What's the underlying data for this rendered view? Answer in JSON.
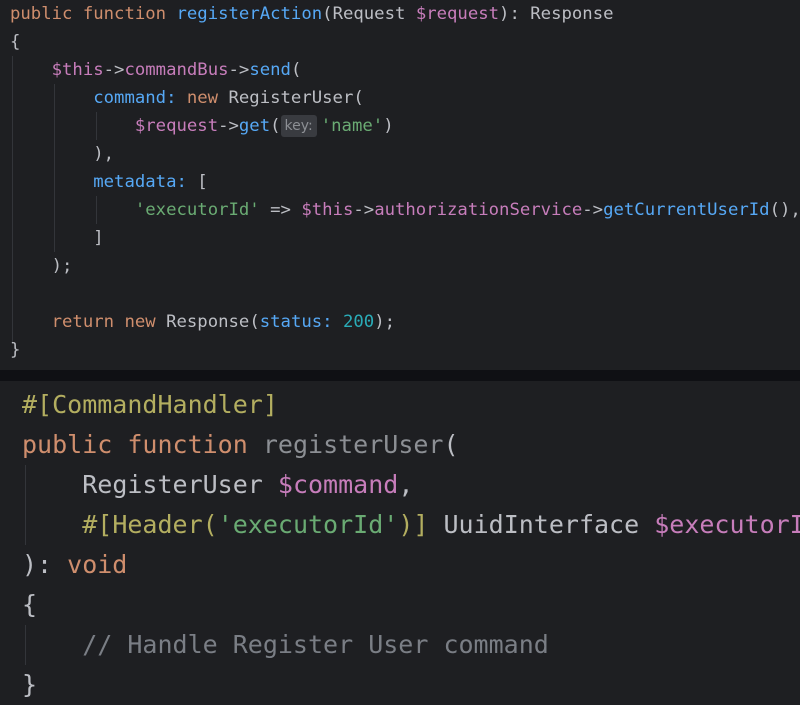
{
  "top_snippet": {
    "l1": {
      "kw_public": "public",
      "kw_function": "function",
      "name": "registerAction",
      "open": "(",
      "type": "Request",
      "var": "$request",
      "close": "): ",
      "ret": "Response"
    },
    "l2": {
      "brace": "{"
    },
    "l3": {
      "this": "$this",
      "arrow1": "->",
      "prop": "commandBus",
      "arrow2": "->",
      "method": "send",
      "paren": "("
    },
    "l4": {
      "param": "command:",
      "kw_new": "new",
      "cls": "RegisterUser",
      "paren": "("
    },
    "l5": {
      "var": "$request",
      "arrow": "->",
      "method": "get",
      "paren": "(",
      "hint": "key:",
      "str": "'name'",
      "close": ")"
    },
    "l6": {
      "text": "),"
    },
    "l7": {
      "param": "metadata:",
      "bracket": "["
    },
    "l8": {
      "str": "'executorId'",
      "op": " => ",
      "this": "$this",
      "arrow1": "->",
      "prop": "authorizationService",
      "arrow2": "->",
      "method": "getCurrentUserId",
      "tail": "(),"
    },
    "l9": {
      "bracket": "]"
    },
    "l10": {
      "text": ");"
    },
    "l12": {
      "kw_return": "return",
      "kw_new": "new",
      "cls": "Response",
      "open": "(",
      "param": "status:",
      "num": "200",
      "close": ");"
    },
    "l13": {
      "brace": "}"
    }
  },
  "bottom_snippet": {
    "l1": {
      "attr": "#[CommandHandler]"
    },
    "l2": {
      "kw_public": "public",
      "kw_function": "function",
      "name": "registerUser",
      "paren": "("
    },
    "l3": {
      "type": "RegisterUser",
      "var": "$command",
      "comma": ","
    },
    "l4": {
      "attr_open": "#[Header(",
      "str": "'executorId'",
      "attr_close": ")]",
      "type": "UuidInterface",
      "var": "$executorId"
    },
    "l5": {
      "close": "): ",
      "kw_void": "void"
    },
    "l6": {
      "brace": "{"
    },
    "l7": {
      "comment": "// Handle Register User command"
    },
    "l8": {
      "brace": "}"
    }
  }
}
